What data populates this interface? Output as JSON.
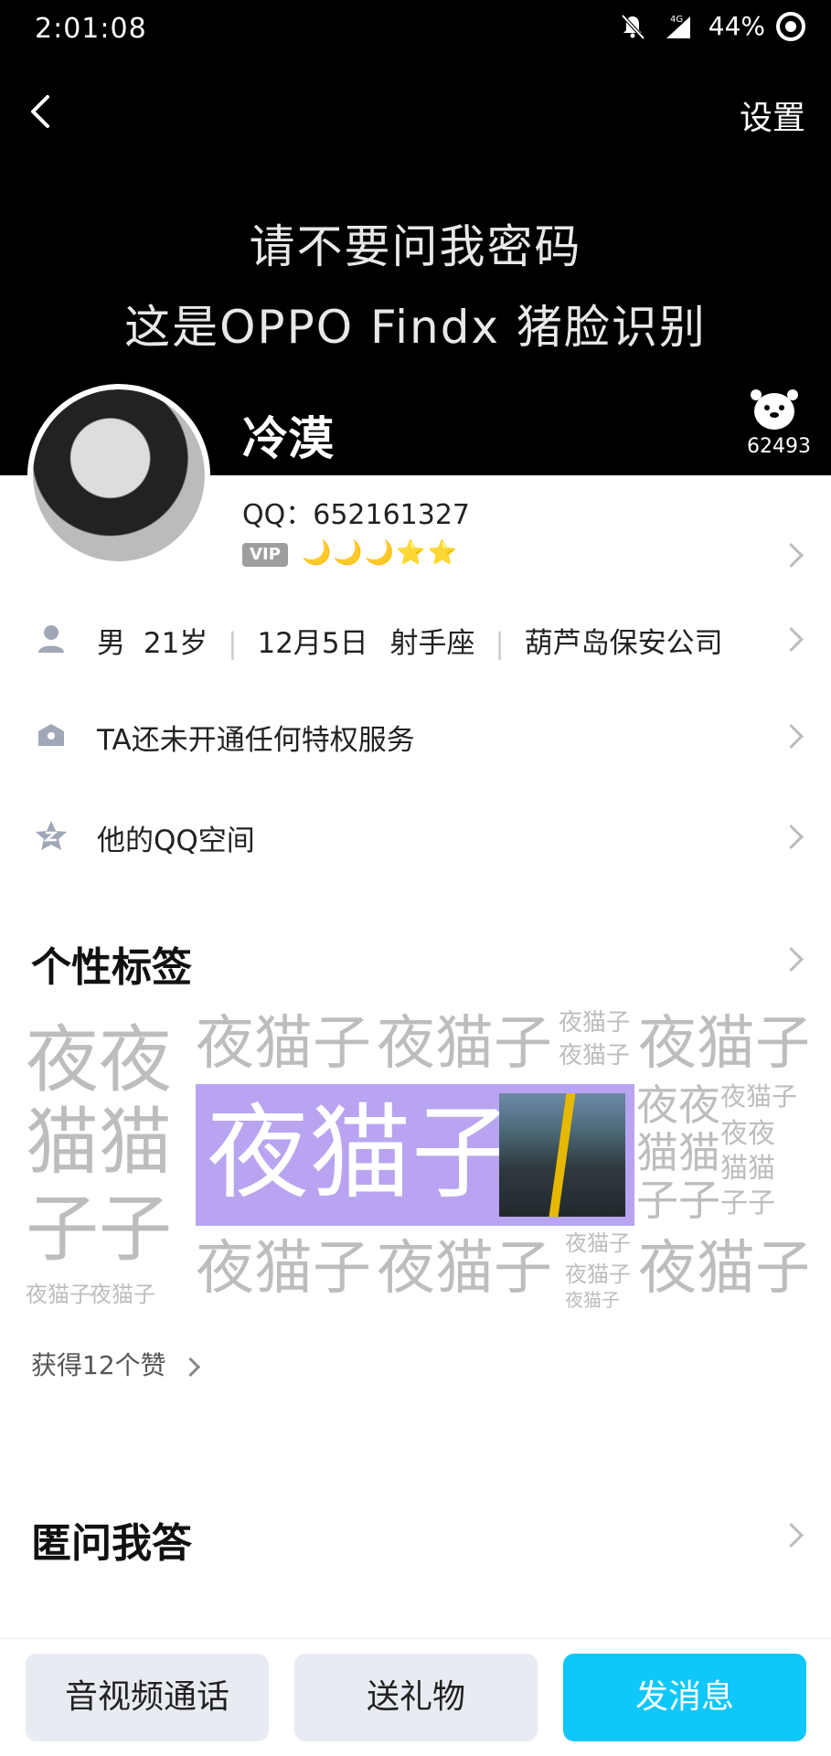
{
  "status": {
    "time": "2:01:08",
    "battery": "44%",
    "network": "4G"
  },
  "header": {
    "settings": "设置"
  },
  "banner": {
    "line1": "请不要问我密码",
    "line2": "这是OPPO Findx  猪脸识别"
  },
  "profile": {
    "name": "冷漠",
    "mascot_count": "62493",
    "qq_label": "QQ：652161327",
    "vip": "VIP",
    "levels": "🌙🌙🌙⭐⭐"
  },
  "info_rows": [
    {
      "gender": "男",
      "age": "21岁",
      "birthday": "12月5日",
      "zodiac": "射手座",
      "company": "葫芦岛保安公司"
    },
    {
      "text": "TA还未开通任何特权服务"
    },
    {
      "text": "他的QQ空间"
    }
  ],
  "tags_section": {
    "title": "个性标签",
    "highlight": "夜猫子",
    "tag_word": "夜猫子",
    "left_big1": "夜夜",
    "left_big2": "猫猫",
    "left_big3": "子子",
    "right_mid1": "夜夜",
    "right_mid2": "猫猫",
    "right_mid3": "子子",
    "likes": "获得12个赞"
  },
  "qa_section": {
    "title": "匿问我答"
  },
  "bottom": {
    "call": "音视频通话",
    "gift": "送礼物",
    "message": "发消息"
  },
  "colors": {
    "accent": "#0fc7fb",
    "tag_highlight": "#b8a4f0"
  }
}
